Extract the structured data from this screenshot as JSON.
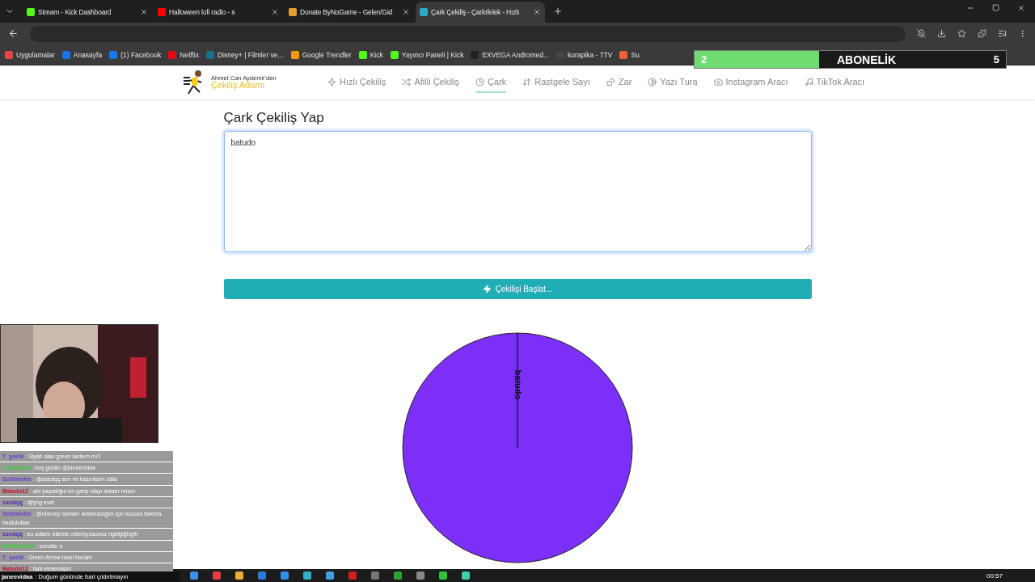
{
  "browser": {
    "tabs": [
      {
        "title": "Stream - Kick Dashboard",
        "selected": false,
        "color": "#53fc18"
      },
      {
        "title": "Halloween lofi radio - s",
        "selected": false,
        "color": "#ff0000"
      },
      {
        "title": "Donate ByNoGame - Gelen/Gid",
        "selected": false,
        "color": "#e0a030"
      },
      {
        "title": "Çark Çekiliş - Çarkıfelek - Hızlı",
        "selected": true,
        "color": "#2aa8c8"
      }
    ],
    "bookmarks": [
      {
        "label": "Uygulamalar",
        "color": "#e04848"
      },
      {
        "label": "Anasayfa",
        "color": "#1a73e8"
      },
      {
        "label": "(1) Facebook",
        "color": "#1877f2"
      },
      {
        "label": "Netflix",
        "color": "#e50914"
      },
      {
        "label": "Disney+ | Filmler ve...",
        "color": "#1e6d8c"
      },
      {
        "label": "Google Trendler",
        "color": "#f29900"
      },
      {
        "label": "Kick",
        "color": "#53fc18"
      },
      {
        "label": "Yayıncı Paneli | Kick",
        "color": "#53fc18"
      },
      {
        "label": "EXVEGA Andromed...",
        "color": "#222222"
      },
      {
        "label": "kurapika - 7TV",
        "color": "#444444"
      },
      {
        "label": "Su",
        "color": "#f06030"
      }
    ]
  },
  "goal": {
    "current": "2",
    "label": "ABONELİK",
    "target": "5",
    "level": 0.4
  },
  "site": {
    "logo_top": "Ahmet Can Aydemir'den",
    "logo_name": "Çekiliş Adamı",
    "nav": [
      {
        "label": "Hızlı Çekiliş",
        "selected": false
      },
      {
        "label": "Afilli Çekiliş",
        "selected": false
      },
      {
        "label": "Çark",
        "selected": true
      },
      {
        "label": "Rastgele Sayı",
        "selected": false
      },
      {
        "label": "Zar",
        "selected": false
      },
      {
        "label": "Yazı Tura",
        "selected": false
      },
      {
        "label": "Instagram Aracı",
        "selected": false
      },
      {
        "label": "TikTok Aracı",
        "selected": false
      }
    ]
  },
  "main": {
    "heading": "Çark Çekiliş Yap",
    "names": "batudo",
    "button": "Çekilişi Başlat...",
    "chart_data": {
      "type": "pie",
      "categories": [
        "batudo"
      ],
      "colors": [
        "#7b2ff7"
      ]
    }
  },
  "chat": {
    "messages": [
      {
        "user": "T_yoelli",
        "text": ": Siyah olan green lantern mı?",
        "color": "#6a3cd0"
      },
      {
        "user": "Cirirbacak",
        "text": ": hoş geldin @janeevidaa",
        "color": "#3cd03c"
      },
      {
        "user": "Sedilmefer",
        "text": ": @ssedqq sen mi hazırladın abla",
        "color": "#6a3cd0"
      },
      {
        "user": "Batudo12",
        "text": ": abi yaşadığın en garip olayı anlatır mısın",
        "color": "#c0102a"
      },
      {
        "user": "ssedqq",
        "text": ": djfşhg evet",
        "color": "#5a2cb0"
      },
      {
        "user": "Sedilmefer",
        "text": ": @ohenep tamam anlamadığım için kusura bakma. mutluluklar.",
        "color": "#6a3cd0"
      },
      {
        "user": "ssedqq",
        "text": ": bu adamı bilerek cıldırtıyosunuz hgkfglğhgfh",
        "color": "#5a2cb0"
      },
      {
        "user": "BelliBelirsiz",
        "text": ": soruldu o",
        "color": "#3cd03c"
      },
      {
        "user": "T_yoelli",
        "text": ": Green Arrow nasıl hocam",
        "color": "#6a3cd0"
      },
      {
        "user": "Batudo12",
        "text": ": fark etmemişim",
        "color": "#c0102a"
      }
    ],
    "alert": {
      "user": "janeevidaa",
      "text": ": Doğum gününde bari çıldırtmayın"
    }
  },
  "taskbar": {
    "time": "00:57"
  }
}
